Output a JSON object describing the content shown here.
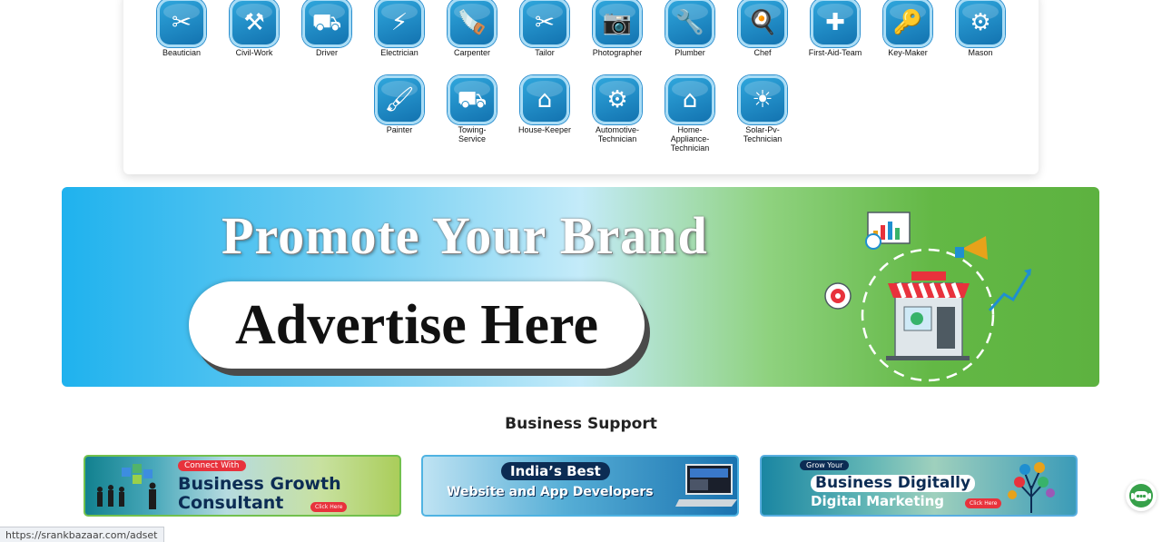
{
  "services": {
    "row1": [
      {
        "label": "Beautician",
        "icon": "beautician-icon",
        "glyph": "✂"
      },
      {
        "label": "Civil-Work",
        "icon": "civil-work-icon",
        "glyph": "⚒"
      },
      {
        "label": "Driver",
        "icon": "driver-icon",
        "glyph": "⛟"
      },
      {
        "label": "Electrician",
        "icon": "electrician-icon",
        "glyph": "⚡"
      },
      {
        "label": "Carpenter",
        "icon": "carpenter-icon",
        "glyph": "🪚"
      },
      {
        "label": "Tailor",
        "icon": "tailor-icon",
        "glyph": "✂"
      },
      {
        "label": "Photographer",
        "icon": "photographer-icon",
        "glyph": "📷"
      },
      {
        "label": "Plumber",
        "icon": "plumber-icon",
        "glyph": "🔧"
      },
      {
        "label": "Chef",
        "icon": "chef-icon",
        "glyph": "🍳"
      },
      {
        "label": "First-Aid-Team",
        "icon": "first-aid-icon",
        "glyph": "✚"
      },
      {
        "label": "Key-Maker",
        "icon": "key-maker-icon",
        "glyph": "🔑"
      },
      {
        "label": "Mason",
        "icon": "mason-icon",
        "glyph": "⚙"
      }
    ],
    "row2": [
      {
        "label": "Painter",
        "icon": "painter-icon",
        "glyph": "🖌"
      },
      {
        "label": "Towing-Service",
        "icon": "towing-service-icon",
        "glyph": "⛟"
      },
      {
        "label": "House-Keeper",
        "icon": "house-keeper-icon",
        "glyph": "⌂"
      },
      {
        "label": "Automotive-Technician",
        "icon": "automotive-technician-icon",
        "glyph": "⚙"
      },
      {
        "label": "Home-Appliance-Technician",
        "icon": "home-appliance-technician-icon",
        "glyph": "⌂"
      },
      {
        "label": "Solar-Pv-Technician",
        "icon": "solar-pv-technician-icon",
        "glyph": "☀"
      }
    ]
  },
  "ad_banner": {
    "title": "Promote Your Brand",
    "cta": "Advertise Here"
  },
  "business_support": {
    "title": "Business Support",
    "promos": [
      {
        "tag": "Connect With",
        "line1": "Business Growth",
        "line2": "Consultant",
        "click": "Click Here"
      },
      {
        "tag": "India’s Best",
        "line1": "Website and App Developers"
      },
      {
        "tag": "Grow Your",
        "line1": "Business Digitally",
        "line2": "Digital Marketing",
        "click": "Click Here"
      }
    ]
  },
  "status_bar": {
    "url": "https://srankbazaar.com/adset"
  },
  "colors": {
    "icon_blue": "#1f8fd0",
    "banner_green": "#5db240",
    "banner_blue": "#1fb2ee",
    "accent_red": "#e8323c"
  }
}
